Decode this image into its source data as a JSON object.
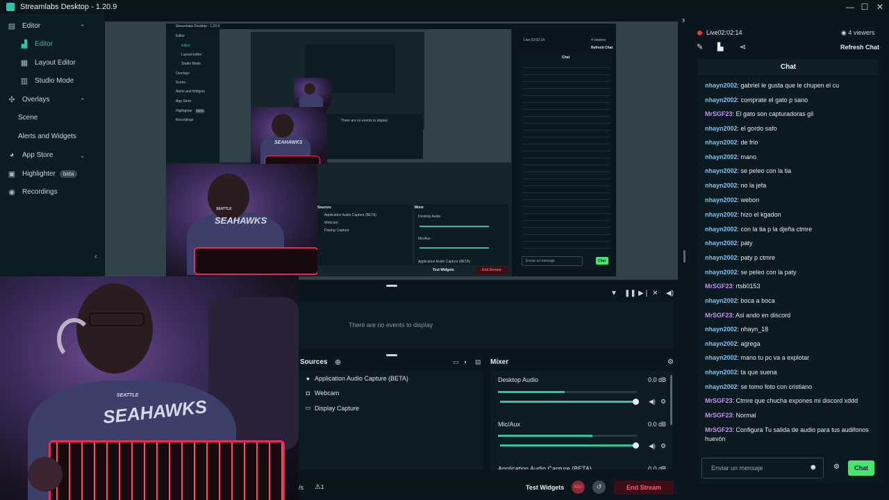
{
  "app": {
    "title": "Streamlabs Desktop - 1.20.9",
    "logo": "SL"
  },
  "window_controls": [
    "—",
    "☐",
    "✕"
  ],
  "sidebar": {
    "items": [
      {
        "label": "Editor",
        "icon": "editor-icon",
        "chev": "⌃"
      },
      {
        "label": "Editor",
        "icon": "editor-sub-icon",
        "active": true
      },
      {
        "label": "Layout Editor",
        "icon": "layout-icon"
      },
      {
        "label": "Studio Mode",
        "icon": "studio-icon"
      },
      {
        "label": "Overlays",
        "icon": "overlays-icon",
        "chev": "⌃"
      },
      {
        "label": "Scene"
      },
      {
        "label": "Alerts and Widgets"
      },
      {
        "label": "App Store",
        "icon": "appstore-icon",
        "chev": "⌄"
      },
      {
        "label": "Highlighter",
        "icon": "highlighter-icon",
        "badge": "beta"
      },
      {
        "label": "Recordings",
        "icon": "recordings-icon"
      }
    ]
  },
  "live": {
    "label": "Live",
    "time": "02:02:14",
    "viewers": "4 viewers"
  },
  "chat": {
    "refresh": "Refresh Chat",
    "header": "Chat",
    "messages": [
      {
        "user": "nhayn2002",
        "text": "gabriel le gusta que le chupen el cu",
        "color": "#7fc4f5"
      },
      {
        "user": "nhayn2002",
        "text": "comprate el gato p sano",
        "color": "#7fc4f5"
      },
      {
        "user": "MrSGF23",
        "text": "El gato son capturadoras gil",
        "color": "#c98ff5"
      },
      {
        "user": "nhayn2002",
        "text": "el gordo safo",
        "color": "#7fc4f5"
      },
      {
        "user": "nhayn2002",
        "text": "de frio",
        "color": "#7fc4f5"
      },
      {
        "user": "nhayn2002",
        "text": "mano",
        "color": "#7fc4f5"
      },
      {
        "user": "nhayn2002",
        "text": "se peleo con la tia",
        "color": "#7fc4f5"
      },
      {
        "user": "nhayn2002",
        "text": "no la jefa",
        "color": "#7fc4f5"
      },
      {
        "user": "nhayn2002",
        "text": "webon",
        "color": "#7fc4f5"
      },
      {
        "user": "nhayn2002",
        "text": "hizo el kgadon",
        "color": "#7fc4f5"
      },
      {
        "user": "nhayn2002",
        "text": "con la tia p la djeña ctmre",
        "color": "#7fc4f5"
      },
      {
        "user": "nhayn2002",
        "text": "paty",
        "color": "#7fc4f5"
      },
      {
        "user": "nhayn2002",
        "text": "paty p ctmre",
        "color": "#7fc4f5"
      },
      {
        "user": "nhayn2002",
        "text": "se peleo con la paty",
        "color": "#7fc4f5"
      },
      {
        "user": "MrSGF23",
        "text": "rtsb0153",
        "color": "#c98ff5"
      },
      {
        "user": "nhayn2002",
        "text": "boca a boca",
        "color": "#7fc4f5"
      },
      {
        "user": "MrSGF23",
        "text": "Asi ando en discord",
        "color": "#c98ff5"
      },
      {
        "user": "nhayn2002",
        "text": "nhayn_18",
        "color": "#7fc4f5"
      },
      {
        "user": "nhayn2002",
        "text": "agrega",
        "color": "#7fc4f5"
      },
      {
        "user": "nhayn2002",
        "text": "mano tu pc va a explotar",
        "color": "#7fc4f5"
      },
      {
        "user": "nhayn2002",
        "text": "ta que suena",
        "color": "#7fc4f5"
      },
      {
        "user": "nhayn2002",
        "text": "se tomo foto con cristiano",
        "color": "#7fc4f5"
      },
      {
        "user": "MrSGF23",
        "text": "Ctmre que chucha expones mi discord xddd",
        "color": "#c98ff5"
      },
      {
        "user": "MrSGF23",
        "text": "Normal",
        "color": "#c98ff5"
      },
      {
        "user": "MrSGF23",
        "text": "Configura Tu salida de audio para tus audifonos huevón",
        "color": "#c98ff5"
      }
    ],
    "input_placeholder": "Enviar un mensaje",
    "send": "Chat"
  },
  "events": {
    "empty": "There are no events to display"
  },
  "sources": {
    "title": "Sources",
    "items": [
      {
        "label": "Application Audio Capture (BETA)",
        "icon": "user-icon"
      },
      {
        "label": "Webcam",
        "icon": "webcam-icon"
      },
      {
        "label": "Display Capture",
        "icon": "monitor-icon"
      }
    ]
  },
  "mixer": {
    "title": "Mixer",
    "channels": [
      {
        "label": "Desktop Audio",
        "db": "0.0 dB",
        "level": 0.48,
        "volume": 1.0
      },
      {
        "label": "Mic/Aux",
        "db": "0.0 dB",
        "level": 0.68,
        "volume": 1.0
      },
      {
        "label": "Application Audio Capture (BETA)",
        "db": "0.0 dB"
      }
    ]
  },
  "footer": {
    "cut_text": "/s",
    "warning_count": "1",
    "test_widgets": "Test Widgets",
    "rec": "REC",
    "end_stream": "End Stream"
  },
  "nested_preview": {
    "title": "Streamlabs Desktop - 1.20.9",
    "live": "Live 02:02:14",
    "viewers": "4 viewers",
    "refresh": "Refresh Chat",
    "chat": "Chat",
    "sources": "Sources",
    "mixer": "Mixer",
    "desktop_audio": "Desktop Audio",
    "mic_aux": "Mic/Aux",
    "app_audio": "Application Audio Capture (BETA)",
    "webcam": "Webcam",
    "display": "Display Capture",
    "events": "There are no events to display",
    "test_widgets": "Test Widgets",
    "end_stream": "End Stream",
    "send": "Chat",
    "placeholder": "Enviar un mensaje",
    "nav": [
      "Editor",
      "Editor",
      "Layout Editor",
      "Studio Mode",
      "Overlays",
      "Scene",
      "Alerts and Widgets",
      "App Store",
      "Highlighter",
      "beta",
      "Recordings"
    ]
  },
  "webcam": {
    "shirt_text": "SEAHAWKS",
    "shirt_sub": "SEATTLE"
  }
}
